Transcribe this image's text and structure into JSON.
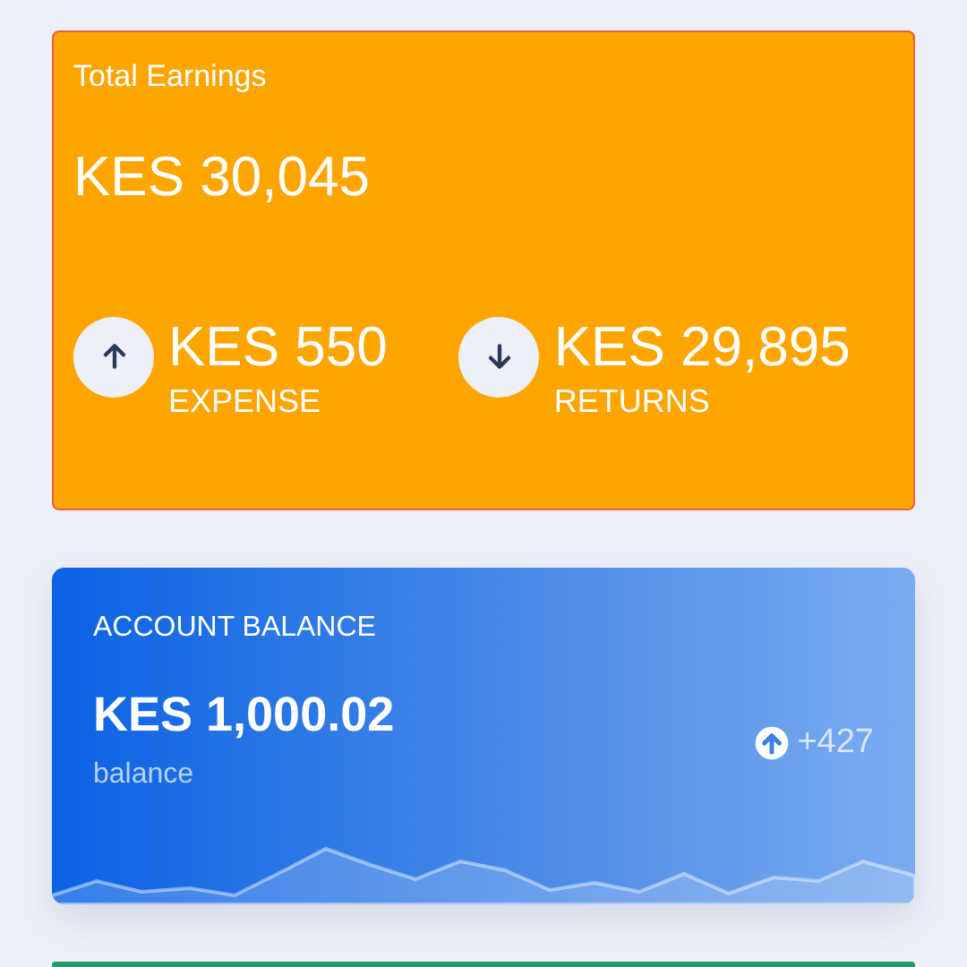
{
  "earnings_card": {
    "title": "Total Earnings",
    "total": "KES 30,045",
    "stats": [
      {
        "kind": "up",
        "amount": "KES 550",
        "label": "EXPENSE"
      },
      {
        "kind": "down",
        "amount": "KES 29,895",
        "label": "RETURNS"
      }
    ]
  },
  "balance_card": {
    "title": "ACCOUNT BALANCE",
    "amount": "KES 1,000.02",
    "caption": "balance",
    "change": {
      "kind": "up",
      "text": "+427"
    }
  }
}
